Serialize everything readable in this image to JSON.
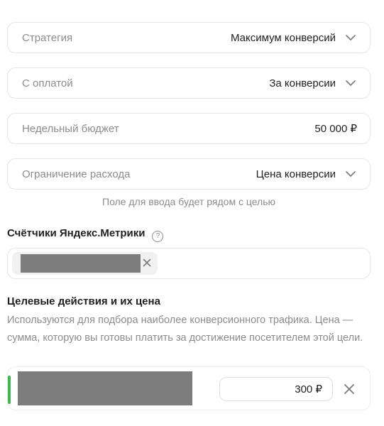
{
  "strategy": {
    "label": "Стратегия",
    "value": "Максимум конверсий"
  },
  "payment": {
    "label": "С оплатой",
    "value": "За конверсии"
  },
  "budget": {
    "label": "Недельный бюджет",
    "value": "50 000 ₽"
  },
  "limit": {
    "label": "Ограничение расхода",
    "value": "Цена конверсии"
  },
  "hint": "Поле для ввода будет рядом с целью",
  "counters": {
    "title": "Счётчики Яндекс.Метрики",
    "help": "?"
  },
  "goals": {
    "title": "Целевые действия и их цена",
    "description": "Используются для подбора наиболее конверсионного трафика. Цена — сумма, которую вы готовы платить за достижение посетителем этой цели.",
    "price": "300 ₽"
  },
  "colors": {
    "accent_green": "#3fb950",
    "mask_gray": "#7d7d7d"
  }
}
